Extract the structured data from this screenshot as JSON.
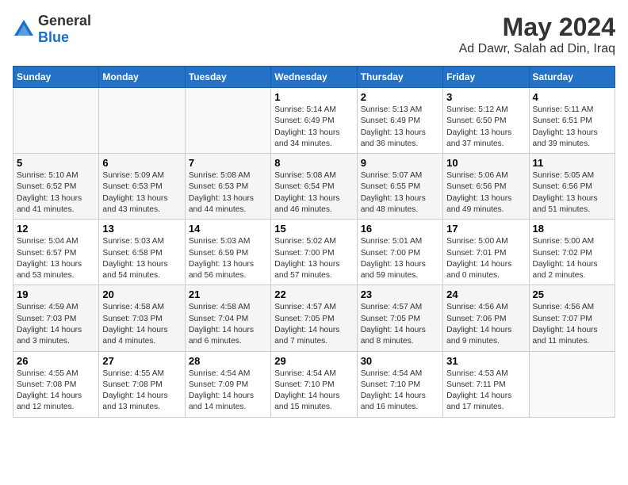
{
  "logo": {
    "general": "General",
    "blue": "Blue"
  },
  "title": "May 2024",
  "subtitle": "Ad Dawr, Salah ad Din, Iraq",
  "headers": [
    "Sunday",
    "Monday",
    "Tuesday",
    "Wednesday",
    "Thursday",
    "Friday",
    "Saturday"
  ],
  "weeks": [
    [
      {
        "day": "",
        "info": ""
      },
      {
        "day": "",
        "info": ""
      },
      {
        "day": "",
        "info": ""
      },
      {
        "day": "1",
        "info": "Sunrise: 5:14 AM\nSunset: 6:49 PM\nDaylight: 13 hours\nand 34 minutes."
      },
      {
        "day": "2",
        "info": "Sunrise: 5:13 AM\nSunset: 6:49 PM\nDaylight: 13 hours\nand 36 minutes."
      },
      {
        "day": "3",
        "info": "Sunrise: 5:12 AM\nSunset: 6:50 PM\nDaylight: 13 hours\nand 37 minutes."
      },
      {
        "day": "4",
        "info": "Sunrise: 5:11 AM\nSunset: 6:51 PM\nDaylight: 13 hours\nand 39 minutes."
      }
    ],
    [
      {
        "day": "5",
        "info": "Sunrise: 5:10 AM\nSunset: 6:52 PM\nDaylight: 13 hours\nand 41 minutes."
      },
      {
        "day": "6",
        "info": "Sunrise: 5:09 AM\nSunset: 6:53 PM\nDaylight: 13 hours\nand 43 minutes."
      },
      {
        "day": "7",
        "info": "Sunrise: 5:08 AM\nSunset: 6:53 PM\nDaylight: 13 hours\nand 44 minutes."
      },
      {
        "day": "8",
        "info": "Sunrise: 5:08 AM\nSunset: 6:54 PM\nDaylight: 13 hours\nand 46 minutes."
      },
      {
        "day": "9",
        "info": "Sunrise: 5:07 AM\nSunset: 6:55 PM\nDaylight: 13 hours\nand 48 minutes."
      },
      {
        "day": "10",
        "info": "Sunrise: 5:06 AM\nSunset: 6:56 PM\nDaylight: 13 hours\nand 49 minutes."
      },
      {
        "day": "11",
        "info": "Sunrise: 5:05 AM\nSunset: 6:56 PM\nDaylight: 13 hours\nand 51 minutes."
      }
    ],
    [
      {
        "day": "12",
        "info": "Sunrise: 5:04 AM\nSunset: 6:57 PM\nDaylight: 13 hours\nand 53 minutes."
      },
      {
        "day": "13",
        "info": "Sunrise: 5:03 AM\nSunset: 6:58 PM\nDaylight: 13 hours\nand 54 minutes."
      },
      {
        "day": "14",
        "info": "Sunrise: 5:03 AM\nSunset: 6:59 PM\nDaylight: 13 hours\nand 56 minutes."
      },
      {
        "day": "15",
        "info": "Sunrise: 5:02 AM\nSunset: 7:00 PM\nDaylight: 13 hours\nand 57 minutes."
      },
      {
        "day": "16",
        "info": "Sunrise: 5:01 AM\nSunset: 7:00 PM\nDaylight: 13 hours\nand 59 minutes."
      },
      {
        "day": "17",
        "info": "Sunrise: 5:00 AM\nSunset: 7:01 PM\nDaylight: 14 hours\nand 0 minutes."
      },
      {
        "day": "18",
        "info": "Sunrise: 5:00 AM\nSunset: 7:02 PM\nDaylight: 14 hours\nand 2 minutes."
      }
    ],
    [
      {
        "day": "19",
        "info": "Sunrise: 4:59 AM\nSunset: 7:03 PM\nDaylight: 14 hours\nand 3 minutes."
      },
      {
        "day": "20",
        "info": "Sunrise: 4:58 AM\nSunset: 7:03 PM\nDaylight: 14 hours\nand 4 minutes."
      },
      {
        "day": "21",
        "info": "Sunrise: 4:58 AM\nSunset: 7:04 PM\nDaylight: 14 hours\nand 6 minutes."
      },
      {
        "day": "22",
        "info": "Sunrise: 4:57 AM\nSunset: 7:05 PM\nDaylight: 14 hours\nand 7 minutes."
      },
      {
        "day": "23",
        "info": "Sunrise: 4:57 AM\nSunset: 7:05 PM\nDaylight: 14 hours\nand 8 minutes."
      },
      {
        "day": "24",
        "info": "Sunrise: 4:56 AM\nSunset: 7:06 PM\nDaylight: 14 hours\nand 9 minutes."
      },
      {
        "day": "25",
        "info": "Sunrise: 4:56 AM\nSunset: 7:07 PM\nDaylight: 14 hours\nand 11 minutes."
      }
    ],
    [
      {
        "day": "26",
        "info": "Sunrise: 4:55 AM\nSunset: 7:08 PM\nDaylight: 14 hours\nand 12 minutes."
      },
      {
        "day": "27",
        "info": "Sunrise: 4:55 AM\nSunset: 7:08 PM\nDaylight: 14 hours\nand 13 minutes."
      },
      {
        "day": "28",
        "info": "Sunrise: 4:54 AM\nSunset: 7:09 PM\nDaylight: 14 hours\nand 14 minutes."
      },
      {
        "day": "29",
        "info": "Sunrise: 4:54 AM\nSunset: 7:10 PM\nDaylight: 14 hours\nand 15 minutes."
      },
      {
        "day": "30",
        "info": "Sunrise: 4:54 AM\nSunset: 7:10 PM\nDaylight: 14 hours\nand 16 minutes."
      },
      {
        "day": "31",
        "info": "Sunrise: 4:53 AM\nSunset: 7:11 PM\nDaylight: 14 hours\nand 17 minutes."
      },
      {
        "day": "",
        "info": ""
      }
    ]
  ]
}
